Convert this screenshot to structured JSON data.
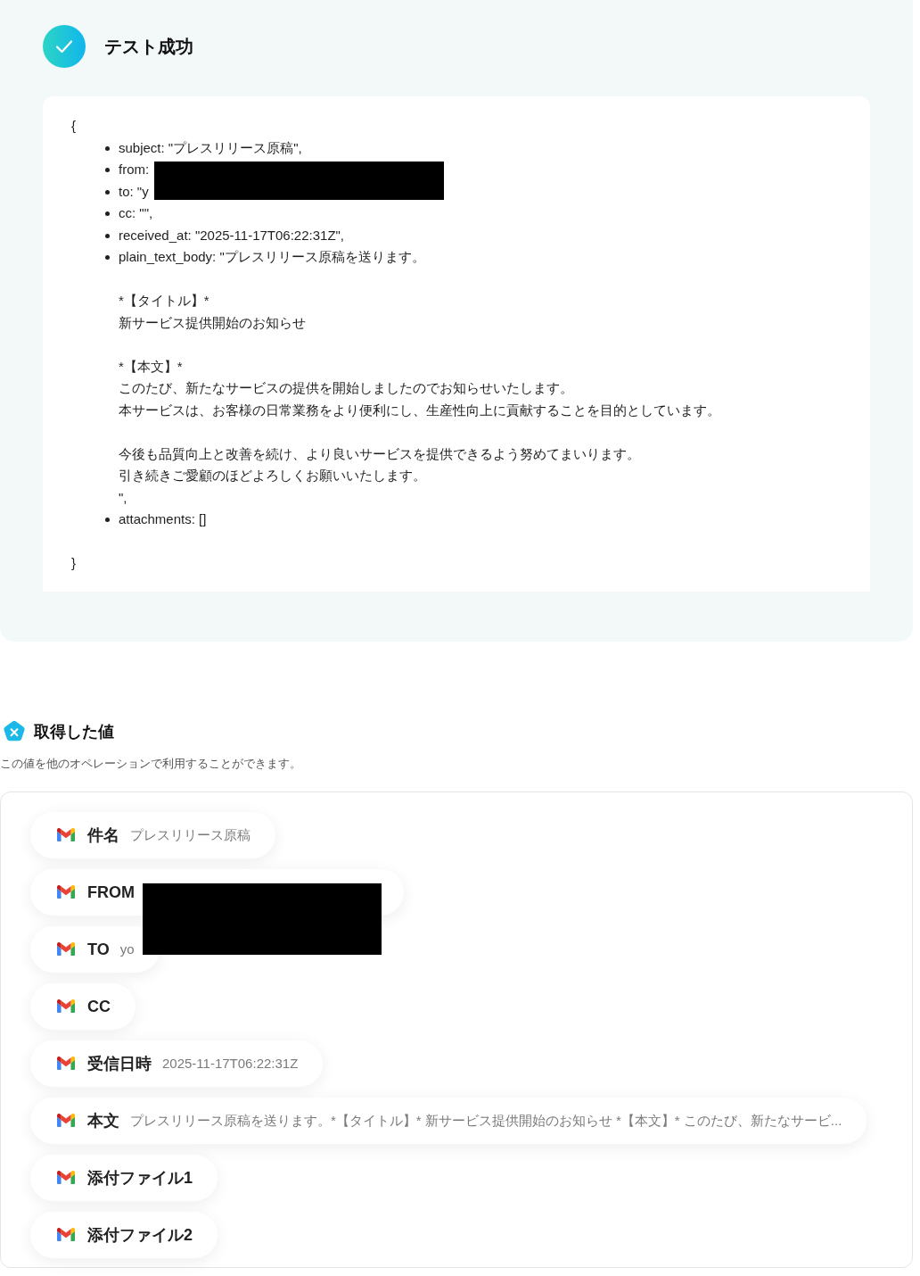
{
  "test_result": {
    "title": "テスト成功"
  },
  "code_block": {
    "open": "{",
    "close": "}",
    "fields": [
      {
        "text": "subject: \"プレスリリース原稿\",",
        "redacted": false
      },
      {
        "text": "from:",
        "redacted": true
      },
      {
        "text": "to: \"y",
        "redacted": true
      },
      {
        "text": "cc: \"\",",
        "redacted": false
      },
      {
        "text": "received_at: \"2025-11-17T06:22:31Z\",",
        "redacted": false
      },
      {
        "text": "plain_text_body: \"プレスリリース原稿を送ります。",
        "paragraphs": [
          {
            "lines": [
              "*【タイトル】*",
              "新サービス提供開始のお知らせ"
            ]
          },
          {
            "lines": [
              "*【本文】*",
              "このたび、新たなサービスの提供を開始しましたのでお知らせいたします。",
              "本サービスは、お客様の日常業務をより便利にし、生産性向上に貢献することを目的としています。"
            ]
          },
          {
            "lines": [
              "今後も品質向上と改善を続け、より良いサービスを提供できるよう努めてまいります。",
              "引き続きご愛顧のほどよろしくお願いいたします。",
              "\","
            ]
          }
        ],
        "redacted": false
      },
      {
        "text": "attachments: []",
        "redacted": false
      }
    ]
  },
  "retrieved_values": {
    "title": "取得した値",
    "description": "この値を他のオペレーションで利用することができます。",
    "items": [
      {
        "label": "件名",
        "value": "プレスリリース原稿",
        "redacted": false
      },
      {
        "label": "FROM",
        "redacted": true
      },
      {
        "label": "TO",
        "value": "yo",
        "redacted": true
      },
      {
        "label": "CC",
        "redacted": false
      },
      {
        "label": "受信日時",
        "value": "2025-11-17T06:22:31Z",
        "redacted": false
      },
      {
        "label": "本文",
        "value": "プレスリリース原稿を送ります。*【タイトル】* 新サービス提供開始のお知らせ *【本文】* このたび、新たなサービ...",
        "redacted": false
      },
      {
        "label": "添付ファイル1",
        "redacted": false
      },
      {
        "label": "添付ファイル2",
        "redacted": false
      }
    ]
  }
}
